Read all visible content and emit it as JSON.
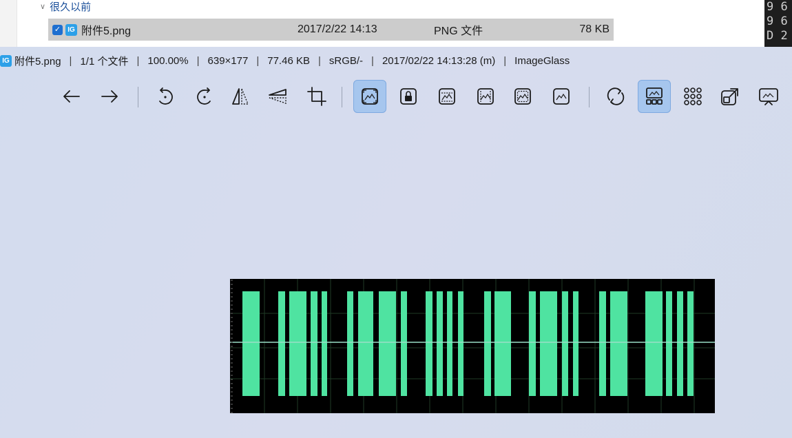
{
  "explorer": {
    "group_header": "很久以前",
    "file": {
      "name": "附件5.png",
      "date": "2017/2/22 14:13",
      "type": "PNG 文件",
      "size": "78 KB"
    },
    "code_strip_text": "9 6\n9 6\nD 2"
  },
  "viewer": {
    "title_segments": [
      "附件5.png",
      "1/1 个文件",
      "100.00%",
      "639×177",
      "77.46 KB",
      "sRGB/-",
      "2017/02/22 14:13:28 (m)",
      "ImageGlass"
    ],
    "toolbar": [
      {
        "icon": "arrow-left-icon",
        "active": false
      },
      {
        "icon": "arrow-right-icon",
        "active": false
      },
      {
        "icon": "rotate-left-icon",
        "active": false
      },
      {
        "icon": "rotate-right-icon",
        "active": false
      },
      {
        "icon": "flip-horizontal-icon",
        "active": false
      },
      {
        "icon": "flip-vertical-icon",
        "active": false
      },
      {
        "icon": "crop-icon",
        "active": false
      },
      {
        "icon": "auto-zoom-icon",
        "active": true
      },
      {
        "icon": "lock-zoom-icon",
        "active": false
      },
      {
        "icon": "scale-to-width-icon",
        "active": false
      },
      {
        "icon": "scale-to-height-icon",
        "active": false
      },
      {
        "icon": "scale-to-fit-icon",
        "active": false
      },
      {
        "icon": "scale-to-fill-icon",
        "active": false
      },
      {
        "icon": "refresh-icon",
        "active": false
      },
      {
        "icon": "thumbnail-bar-icon",
        "active": true
      },
      {
        "icon": "gallery-icon",
        "active": false
      },
      {
        "icon": "open-external-icon",
        "active": false
      },
      {
        "icon": "slideshow-icon",
        "active": false
      }
    ],
    "image": {
      "background": "#000000",
      "bar_color": "#4fe3a1",
      "baseline_color": "#9adfc8",
      "grid_color": "#1f3a26"
    }
  }
}
